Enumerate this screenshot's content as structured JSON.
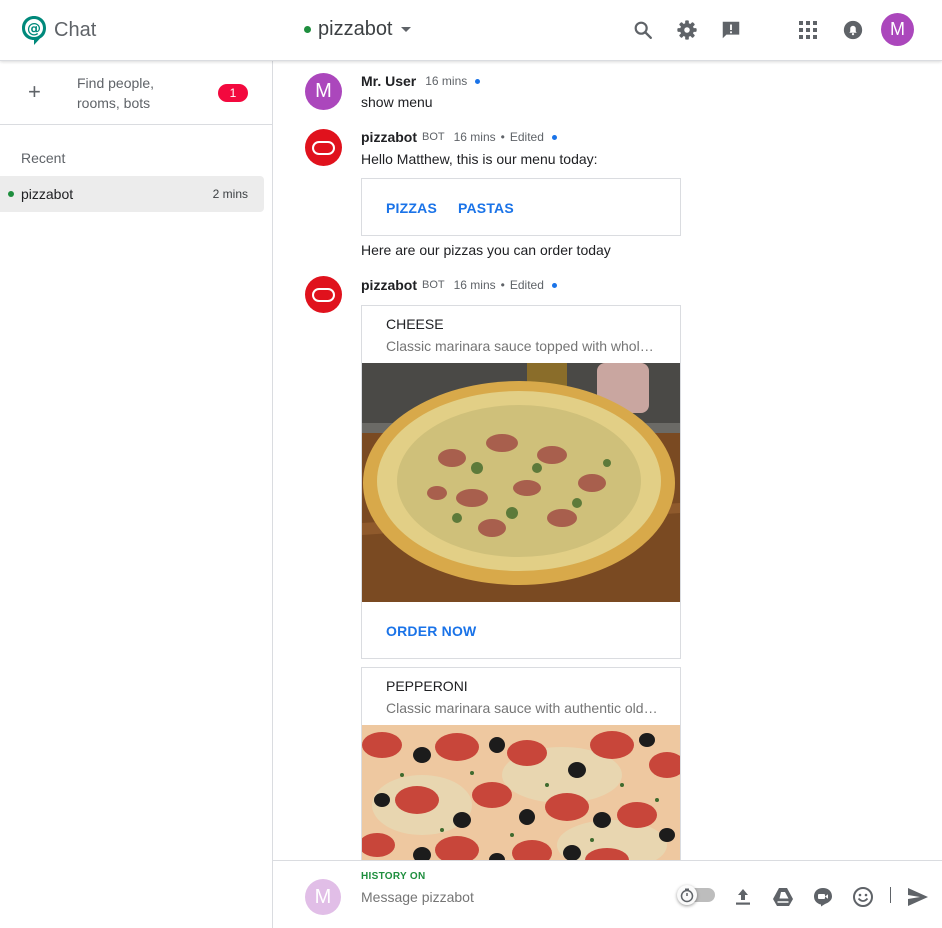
{
  "app": {
    "name": "Chat"
  },
  "header": {
    "room_name": "pizzabot"
  },
  "sidebar": {
    "find_label": "Find people, rooms, bots",
    "find_badge": "1",
    "recent_label": "Recent",
    "rooms": [
      {
        "name": "pizzabot",
        "time": "2 mins",
        "status": "online"
      }
    ]
  },
  "messages": [
    {
      "author": "Mr. User",
      "avatar_letter": "M",
      "time": "16 mins",
      "text": "show menu"
    },
    {
      "author": "pizzabot",
      "tag": "BOT",
      "time": "16 mins",
      "edited": "Edited",
      "text": "Hello Matthew, this is our menu today:",
      "card_buttons": [
        "PIZZAS",
        "PASTAS"
      ],
      "after_text": "Here are our pizzas you can order today"
    },
    {
      "author": "pizzabot",
      "tag": "BOT",
      "time": "16 mins",
      "edited": "Edited",
      "cards": [
        {
          "title": "CHEESE",
          "subtitle": "Classic marinara sauce topped with whole milk mozzarella cheese.",
          "action": "ORDER NOW",
          "image": "cheese-pizza-photo"
        },
        {
          "title": "PEPPERONI",
          "subtitle": "Classic marinara sauce with authentic old-world style pepperoni.",
          "image": "pepperoni-pizza-photo"
        }
      ]
    }
  ],
  "composer": {
    "history_label": "HISTORY ON",
    "placeholder": "Message pizzabot",
    "avatar_letter": "M"
  },
  "user": {
    "avatar_letter": "M"
  },
  "colors": {
    "accent": "#1a73e8",
    "online": "#1e8e3e",
    "bot_avatar": "#e0121d",
    "user_avatar": "#ab47bc",
    "badge": "#f3093e"
  },
  "icons": {
    "header": [
      "search-icon",
      "gear-icon",
      "feedback-icon",
      "apps-grid-icon",
      "notifications-icon"
    ],
    "composer": [
      "timer-icon",
      "upload-icon",
      "drive-icon",
      "meet-icon",
      "emoji-icon",
      "send-icon"
    ]
  }
}
